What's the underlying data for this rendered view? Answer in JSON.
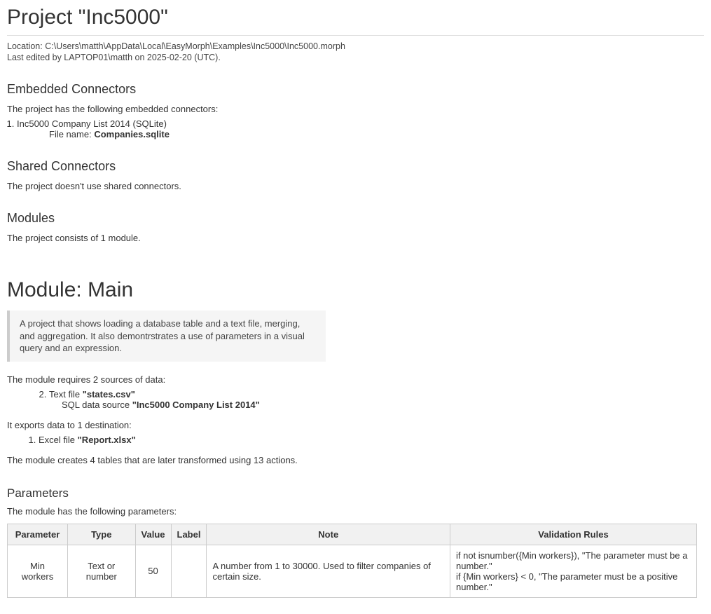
{
  "project": {
    "title": "Project \"Inc5000\"",
    "location_line": "Location: C:\\Users\\matth\\AppData\\Local\\EasyMorph\\Examples\\Inc5000\\Inc5000.morph",
    "last_edited_line": "Last edited by LAPTOP01\\matth on 2025-02-20 (UTC)."
  },
  "embedded": {
    "heading": "Embedded Connectors",
    "intro": "The project has the following embedded connectors:",
    "item": "Inc5000 Company List 2014 (SQLite)",
    "file_label": "File name: ",
    "file_name": "Companies.sqlite"
  },
  "shared": {
    "heading": "Shared Connectors",
    "text": "The project doesn't use shared connectors."
  },
  "modules": {
    "heading": "Modules",
    "text": "The project consists of 1 module."
  },
  "module": {
    "title": "Module: Main",
    "description": "A project that shows loading a database table and a text file, merging, and aggregation. It also demontrstrates a use of parameters in a visual query and an expression.",
    "sources_intro": "The module requires 2 sources of data:",
    "source_text_prefix": "Text file ",
    "source_text_name": "\"states.csv\"",
    "source_sql_prefix": "SQL data source ",
    "source_sql_name": "\"Inc5000 Company List 2014\"",
    "dest_intro": "It exports data to 1 destination:",
    "dest_prefix": "Excel file ",
    "dest_name": "\"Report.xlsx\"",
    "tables_line": "The module creates 4 tables that are later transformed using 13 actions."
  },
  "parameters": {
    "heading": "Parameters",
    "intro": "The module has the following parameters:",
    "headers": {
      "parameter": "Parameter",
      "type": "Type",
      "value": "Value",
      "label": "Label",
      "note": "Note",
      "validation": "Validation Rules"
    },
    "row": {
      "parameter": "Min workers",
      "type": "Text or number",
      "value": "50",
      "label": "",
      "note": "A number from 1 to 30000. Used to filter companies of certain size.",
      "rule1": "if not isnumber({Min workers}), \"The parameter must be a number.\"",
      "rule2": "if {Min workers} < 0, \"The parameter must be a positive number.\""
    }
  }
}
